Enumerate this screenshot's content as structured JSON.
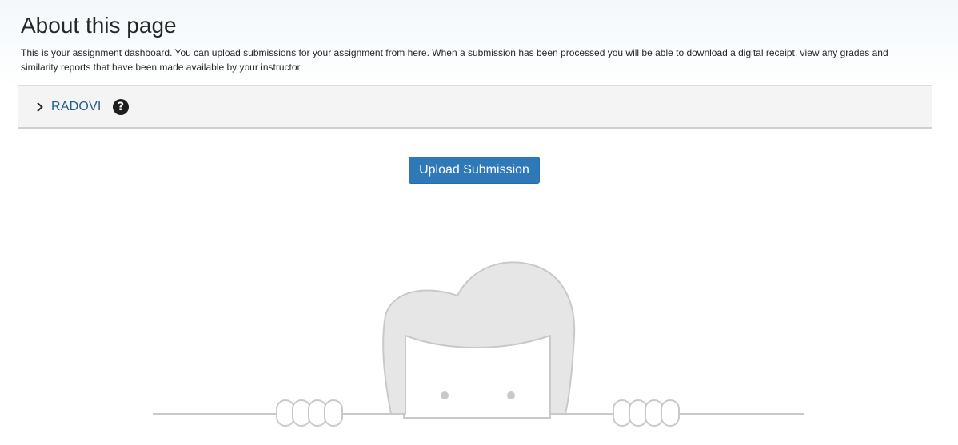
{
  "about": {
    "title": "About this page",
    "description": "This is your assignment dashboard. You can upload submissions for your assignment from here. When a submission has been processed you will be able to download a digital receipt, view any grades and similarity reports that have been made available by your instructor."
  },
  "assignment": {
    "title": "RADOVI",
    "help_symbol": "?",
    "expand_icon": "chevron-right-icon",
    "help_icon": "question-circle-icon"
  },
  "actions": {
    "upload_label": "Upload Submission"
  },
  "illustration": {
    "name": "empty-state-peeking-character"
  },
  "colors": {
    "primary_button": "#2f79b9",
    "link": "#1f5f8b",
    "panel_background": "#f4f4f4",
    "illustration_fill": "#e6e6e6",
    "illustration_stroke": "#c9c9c9"
  }
}
